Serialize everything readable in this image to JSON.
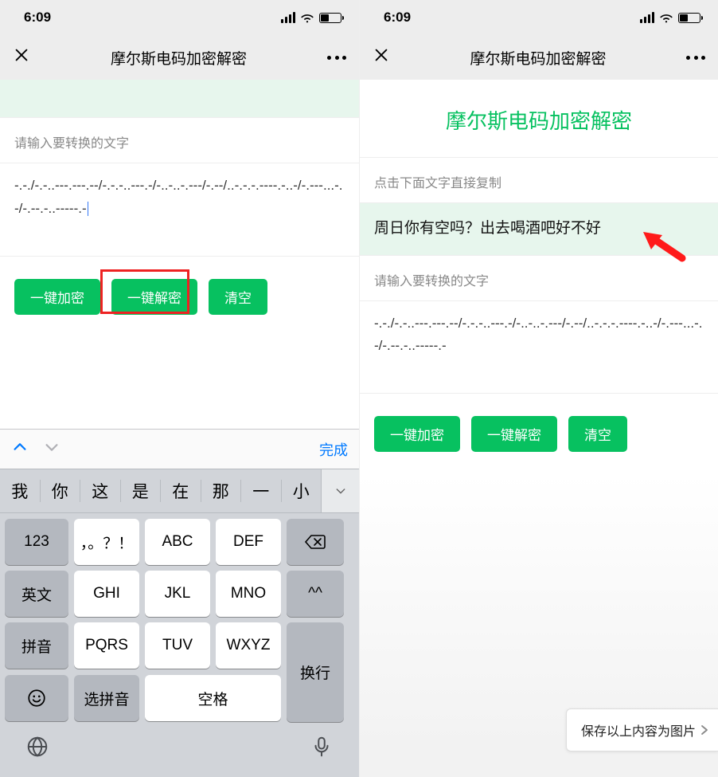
{
  "status": {
    "time": "6:09"
  },
  "nav": {
    "title": "摩尔斯电码加密解密"
  },
  "left": {
    "placeholder": "请输入要转换的文字",
    "morse": "-.-./-.-..---.---.--/-.-.-..---.-/-..-..-.---/-.--/..-.-.-.----.-..-/-.---...-.-/-.--.-..-----.-",
    "buttons": {
      "encrypt": "一键加密",
      "decrypt": "一键解密",
      "clear": "清空"
    },
    "accessory_done": "完成",
    "keyboard": {
      "suggestions": [
        "我",
        "你",
        "这",
        "是",
        "在",
        "那",
        "一",
        "小"
      ],
      "rows": [
        [
          "123",
          "，。？！",
          "ABC",
          "DEF",
          "delete"
        ],
        [
          "英文",
          "GHI",
          "JKL",
          "MNO",
          "^^"
        ],
        [
          "拼音",
          "PQRS",
          "TUV",
          "WXYZ",
          "换行"
        ],
        [
          "😀",
          "选拼音",
          "空格"
        ]
      ]
    }
  },
  "right": {
    "green_title": "摩尔斯电码加密解密",
    "copy_hint": "点击下面文字直接复制",
    "result_text": "周日你有空吗？出去喝酒吧好不好",
    "placeholder": "请输入要转换的文字",
    "morse": "-.-./-.-..---.---.--/-.-.-..---.-/-..-..-.---/-.--/..-.-.-.----.-..-/-.---...-.-/-.--.-..-----.-",
    "buttons": {
      "encrypt": "一键加密",
      "decrypt": "一键解密",
      "clear": "清空"
    },
    "save_label": "保存以上内容为图片"
  }
}
